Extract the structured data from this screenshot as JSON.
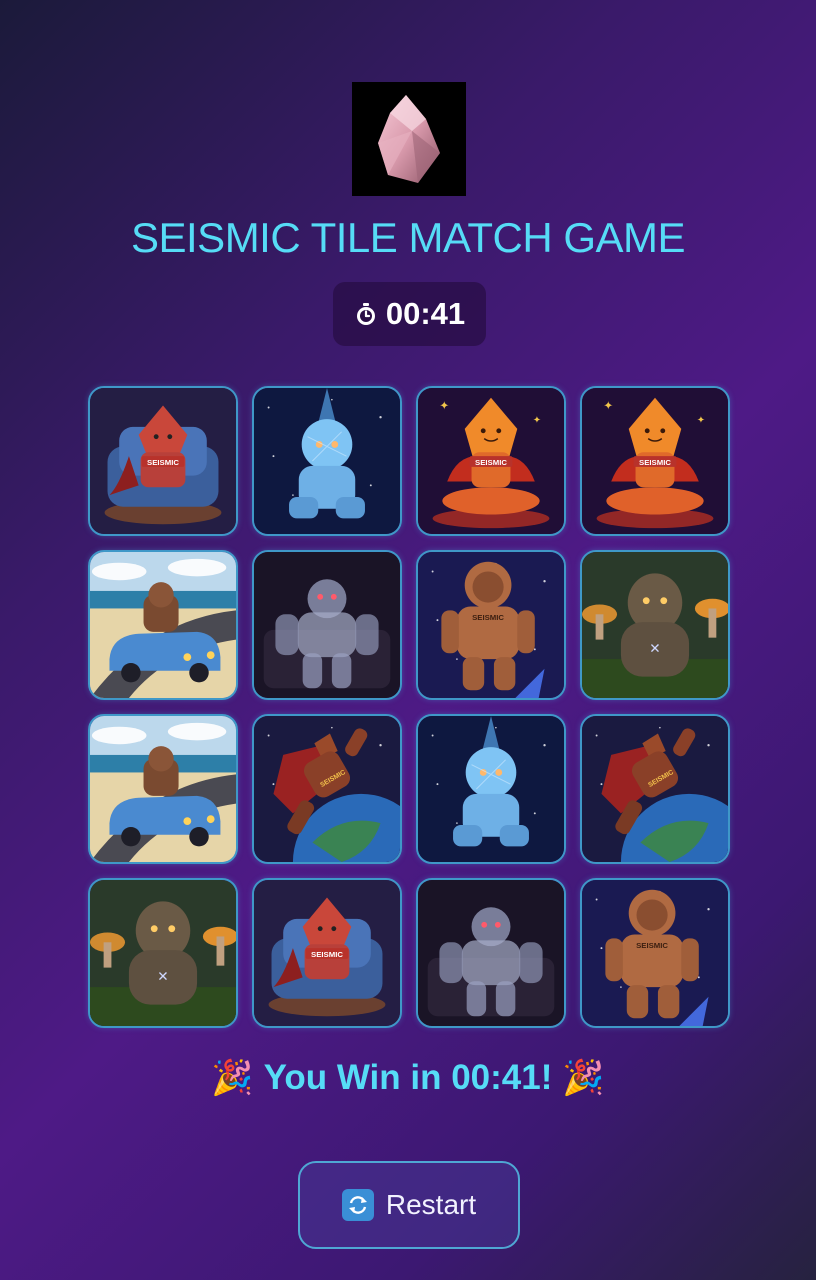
{
  "game": {
    "title": "SEISMIC TILE MATCH GAME",
    "timer": "00:41",
    "timer_icon": "stopwatch-icon",
    "win_message": "You Win in 00:41!",
    "win_icon": "party-popper-icon",
    "restart_label": "Restart",
    "restart_icon": "restart-arrows-icon",
    "logo": "pink-crystal-logo"
  },
  "tiles": [
    {
      "row": 1,
      "col": 1,
      "image": "armchair-golem",
      "caption": "SEISMIC"
    },
    {
      "row": 1,
      "col": 2,
      "image": "ice-crystal-golem",
      "caption": ""
    },
    {
      "row": 1,
      "col": 3,
      "image": "meditating-crystal",
      "caption": "SEISMIC"
    },
    {
      "row": 1,
      "col": 4,
      "image": "meditating-crystal",
      "caption": "SEISMIC"
    },
    {
      "row": 2,
      "col": 1,
      "image": "car-road-golem",
      "caption": ""
    },
    {
      "row": 2,
      "col": 2,
      "image": "glass-robot-golem",
      "caption": ""
    },
    {
      "row": 2,
      "col": 3,
      "image": "astronaut-golem",
      "caption": "SEISMIC"
    },
    {
      "row": 2,
      "col": 4,
      "image": "stone-forest-golem",
      "caption": ""
    },
    {
      "row": 3,
      "col": 1,
      "image": "car-road-golem",
      "caption": ""
    },
    {
      "row": 3,
      "col": 2,
      "image": "flying-hero-earth",
      "caption": "SEISMIC"
    },
    {
      "row": 3,
      "col": 3,
      "image": "ice-crystal-golem",
      "caption": ""
    },
    {
      "row": 3,
      "col": 4,
      "image": "flying-hero-earth",
      "caption": "SEISMIC"
    },
    {
      "row": 4,
      "col": 1,
      "image": "stone-forest-golem",
      "caption": ""
    },
    {
      "row": 4,
      "col": 2,
      "image": "armchair-golem",
      "caption": "SEISMIC"
    },
    {
      "row": 4,
      "col": 3,
      "image": "glass-robot-golem",
      "caption": ""
    },
    {
      "row": 4,
      "col": 4,
      "image": "astronaut-golem",
      "caption": "SEISMIC"
    }
  ],
  "colors": {
    "title": "#56dcf6",
    "tile_border": "#3f98c8",
    "background_start": "#1b1a3a",
    "background_mid": "#4e1a86"
  }
}
